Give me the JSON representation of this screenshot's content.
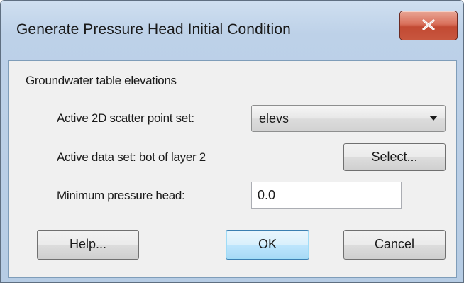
{
  "window": {
    "title": "Generate Pressure Head Initial Condition"
  },
  "group": {
    "label": "Groundwater table elevations"
  },
  "scatter": {
    "label": "Active 2D scatter point set:",
    "selected": "elevs"
  },
  "dataset": {
    "label": "Active data set:  bot of layer 2",
    "select_button": "Select..."
  },
  "pressure": {
    "label": "Minimum pressure head:",
    "value": "0.0"
  },
  "buttons": {
    "help": "Help...",
    "ok": "OK",
    "cancel": "Cancel"
  },
  "icons": {
    "close": "close-icon",
    "dropdown": "chevron-down-icon"
  },
  "colors": {
    "frame": "#b6cce4",
    "close_button": "#c8563e",
    "default_button": "#bee6fd"
  }
}
